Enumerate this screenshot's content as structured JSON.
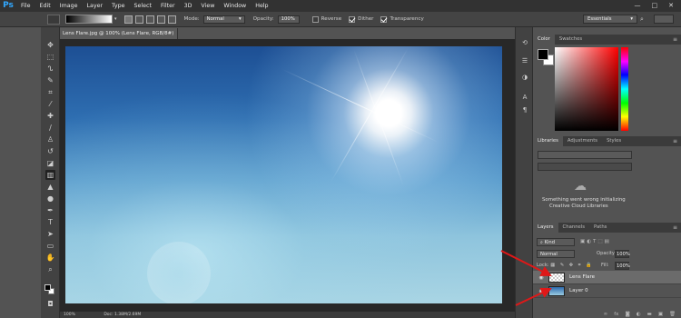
{
  "app": {
    "logo": "Ps"
  },
  "menu": [
    "File",
    "Edit",
    "Image",
    "Layer",
    "Type",
    "Select",
    "Filter",
    "3D",
    "View",
    "Window",
    "Help"
  ],
  "window_controls": {
    "minimize": "—",
    "maximize": "□",
    "close": "✕"
  },
  "options_bar": {
    "mode_label": "Mode:",
    "mode_value": "Normal",
    "opacity_label": "Opacity:",
    "opacity_value": "100%",
    "reverse_label": "Reverse",
    "dither_label": "Dither",
    "transparency_label": "Transparency",
    "reverse_checked": false,
    "dither_checked": true,
    "transparency_checked": true,
    "workspace": "Essentials"
  },
  "document": {
    "tab_title": "Lens Flare.jpg @ 100% (Lens Flare, RGB/8#) *",
    "zoom": "100%",
    "doc_info": "Doc: 1.38M/2.69M"
  },
  "tools": [
    "move-icon",
    "marquee-icon",
    "lasso-icon",
    "quick-select-icon",
    "crop-icon",
    "eyedropper-icon",
    "healing-icon",
    "brush-icon",
    "clone-stamp-icon",
    "history-brush-icon",
    "eraser-icon",
    "gradient-icon",
    "blur-icon",
    "dodge-icon",
    "pen-icon",
    "type-icon",
    "path-select-icon",
    "rectangle-icon",
    "hand-icon",
    "zoom-icon"
  ],
  "color_panel": {
    "tabs": [
      "Color",
      "Swatches"
    ],
    "foreground": "#000000",
    "background": "#ffffff"
  },
  "libraries_panel": {
    "tabs": [
      "Libraries",
      "Adjustments",
      "Styles"
    ],
    "message_line1": "Something went wrong initializing",
    "message_line2": "Creative Cloud Libraries"
  },
  "layers_panel": {
    "tabs": [
      "Layers",
      "Channels",
      "Paths"
    ],
    "kind_value": "Kind",
    "blend_mode": "Normal",
    "opacity_label": "Opacity:",
    "opacity_value": "100%",
    "lock_label": "Lock:",
    "fill_label": "Fill:",
    "fill_value": "100%",
    "layers": [
      {
        "name": "Lens Flare",
        "visible": true,
        "selected": true,
        "thumbnail": "transparent"
      },
      {
        "name": "Layer 0",
        "visible": true,
        "selected": false,
        "thumbnail": "sky"
      }
    ]
  },
  "colors": {
    "ps_blue": "#31a8ff",
    "arrow_red": "#e01818",
    "panel_bg": "#535353",
    "dark_chrome": "#323232"
  }
}
